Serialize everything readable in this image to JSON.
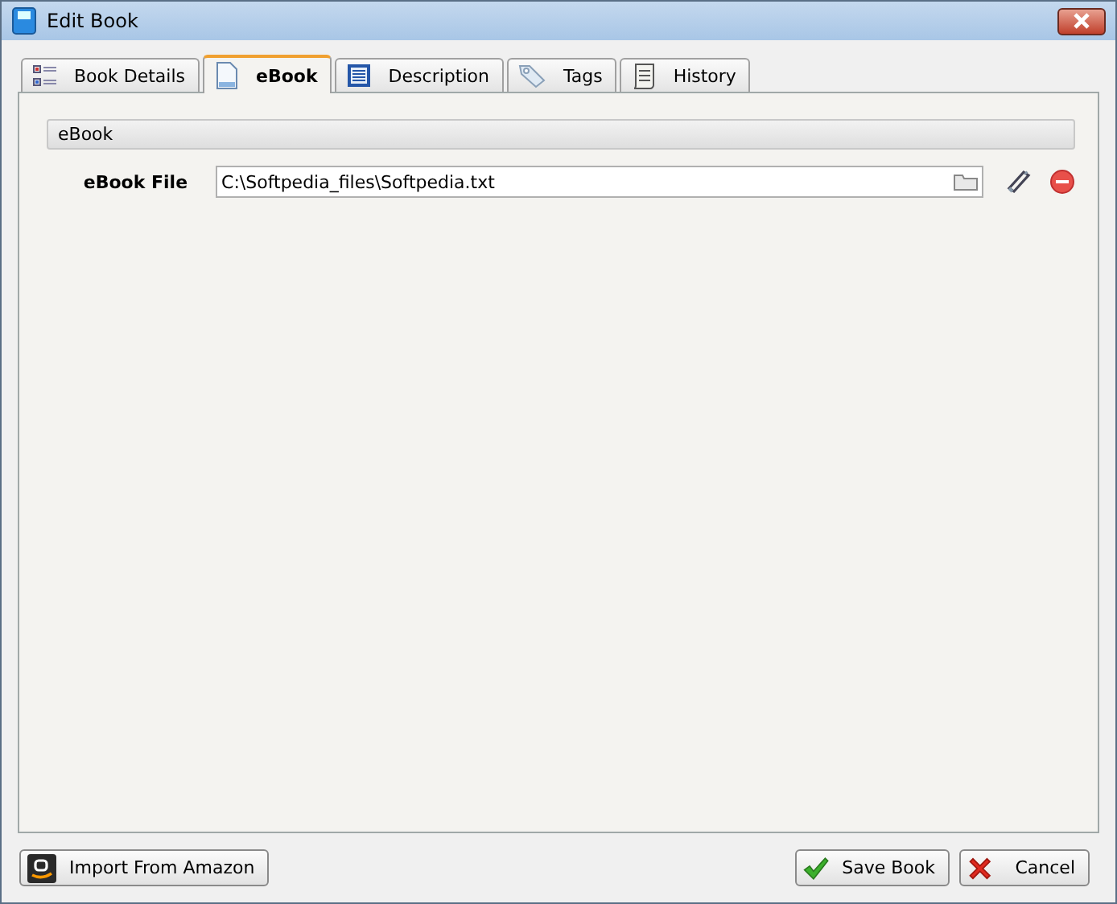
{
  "window": {
    "title": "Edit Book"
  },
  "tabs": [
    {
      "label": "Book Details",
      "kind": "details",
      "selected": false
    },
    {
      "label": "eBook",
      "kind": "ebook",
      "selected": true
    },
    {
      "label": "Description",
      "kind": "description",
      "selected": false
    },
    {
      "label": "Tags",
      "kind": "tags",
      "selected": false
    },
    {
      "label": "History",
      "kind": "history",
      "selected": false
    }
  ],
  "section": {
    "title": "eBook"
  },
  "ebook_file": {
    "label": "eBook File",
    "value": "C:\\Softpedia_files\\Softpedia.txt"
  },
  "buttons": [
    {
      "label": "Import From Amazon",
      "kind": "amazon"
    },
    {
      "label": "Save Book",
      "kind": "save"
    },
    {
      "label": "Cancel",
      "kind": "cancel"
    }
  ]
}
